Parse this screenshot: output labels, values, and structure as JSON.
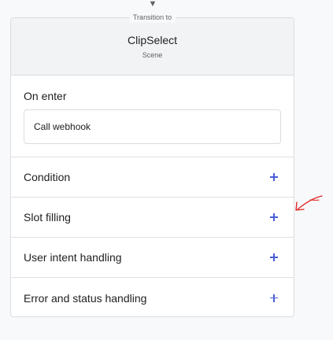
{
  "transition": {
    "arrow_glyph": "▼",
    "label": "Transition to"
  },
  "page": {
    "title": "ClipSelect",
    "type": "Scene"
  },
  "on_enter": {
    "title": "On enter",
    "webhook_label": "Call webhook"
  },
  "sections": [
    {
      "label": "Condition",
      "action_icon": "plus-icon"
    },
    {
      "label": "Slot filling",
      "action_icon": "plus-icon"
    },
    {
      "label": "User intent handling",
      "action_icon": "plus-icon"
    },
    {
      "label": "Error and status handling",
      "action_icon": "plus-icon"
    }
  ],
  "colors": {
    "accent": "#4a5fd8",
    "annotation": "#e02020",
    "header_bg": "#f1f3f4",
    "border": "#dadce0"
  }
}
